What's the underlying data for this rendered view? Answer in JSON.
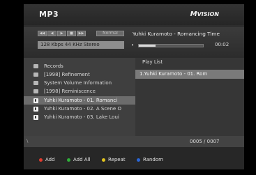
{
  "header": {
    "title": "MP3",
    "brand_prefix": "M",
    "brand_name": "VISION"
  },
  "player": {
    "control_icons": [
      "skip-back-icon",
      "rewind-icon",
      "fast-forward-icon",
      "stop-icon",
      "play-icon"
    ],
    "mode_label": "Normal",
    "bitrate_text": "128 Kbps  44 KHz  Stereo",
    "now_playing": "Yuhki Kuramoto - Romancing Time",
    "progress": 0.26,
    "elapsed_time": "00:02"
  },
  "browser": {
    "items": [
      {
        "label": "Records",
        "type": "folder",
        "selected": false
      },
      {
        "label": "[1998] Refinement",
        "type": "folder",
        "selected": false
      },
      {
        "label": "System Volume Information",
        "type": "folder",
        "selected": false
      },
      {
        "label": "[1998] Reminiscence",
        "type": "folder",
        "selected": false
      },
      {
        "label": "Yuhki Kuramoto - 01. Romanci",
        "type": "music",
        "selected": true
      },
      {
        "label": "Yuhki Kuramoto - 02. A Scene O",
        "type": "music",
        "selected": false
      },
      {
        "label": "Yuhki Kuramoto - 03. Lake Loui",
        "type": "music",
        "selected": false
      }
    ]
  },
  "playlist": {
    "header": "Play List",
    "items": [
      "1.Yuhki Kuramoto - 01. Rom"
    ]
  },
  "status": {
    "left": "\\",
    "count": "0005 / 0007"
  },
  "legend": [
    {
      "label": "Add",
      "color": "#e03b2e"
    },
    {
      "label": "Add All",
      "color": "#2fae3a"
    },
    {
      "label": "Repeat",
      "color": "#e0c21f"
    },
    {
      "label": "Random",
      "color": "#2a66d6"
    }
  ]
}
